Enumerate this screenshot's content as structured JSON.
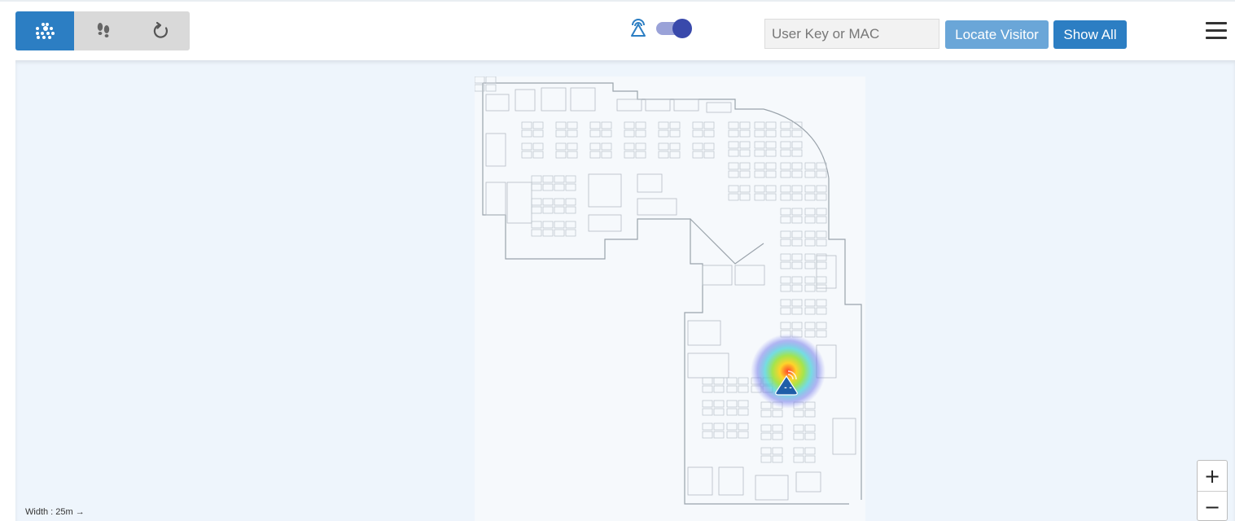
{
  "toolbar": {
    "mode_buttons": [
      {
        "icon": "clients-dots-icon",
        "active": true
      },
      {
        "icon": "footprints-icon",
        "active": false
      },
      {
        "icon": "refresh-icon",
        "active": false
      }
    ],
    "toggle": {
      "icon": "signal-beacon-icon",
      "on": true
    },
    "search": {
      "placeholder": "User Key or MAC",
      "value": ""
    },
    "locate_label": "Locate Visitor",
    "show_all_label": "Show All",
    "menu_icon": "hamburger-menu-icon"
  },
  "map": {
    "scale_label": "Width : 25m",
    "scale_arrow": "→",
    "visitor_marker": {
      "label": "- -",
      "icon": "visitor-marker-icon"
    },
    "zoom_in": "+",
    "zoom_out": "−"
  },
  "colors": {
    "primary": "#2c7ec3",
    "secondary_button": "#6aa6d8",
    "toggle_knob": "#3949ab",
    "map_background": "#eef5fc"
  }
}
